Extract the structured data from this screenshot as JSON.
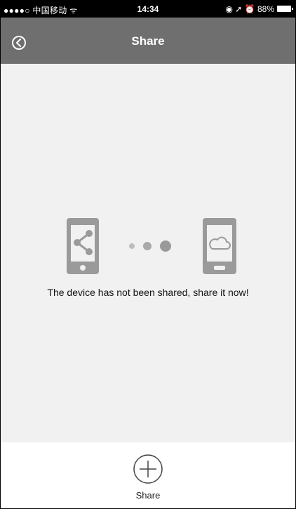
{
  "status_bar": {
    "carrier": "●●●●○ 中国移动 ᯤ",
    "time": "14:34",
    "right": "◉ ➚ ⏰ 88%"
  },
  "header": {
    "title": "Share",
    "back_icon": "chevron-left-circle-icon"
  },
  "empty_state": {
    "message": "The device has not been shared, share it now!",
    "icons": [
      "phone-share-icon",
      "dots-icon",
      "phone-cloud-icon"
    ]
  },
  "bottom": {
    "share_label": "Share",
    "share_icon": "plus-circle-icon"
  },
  "colors": {
    "nav_bar": "#6f6f6f",
    "background": "#f1f1f2",
    "icon_gray": "#9a9a9a"
  }
}
